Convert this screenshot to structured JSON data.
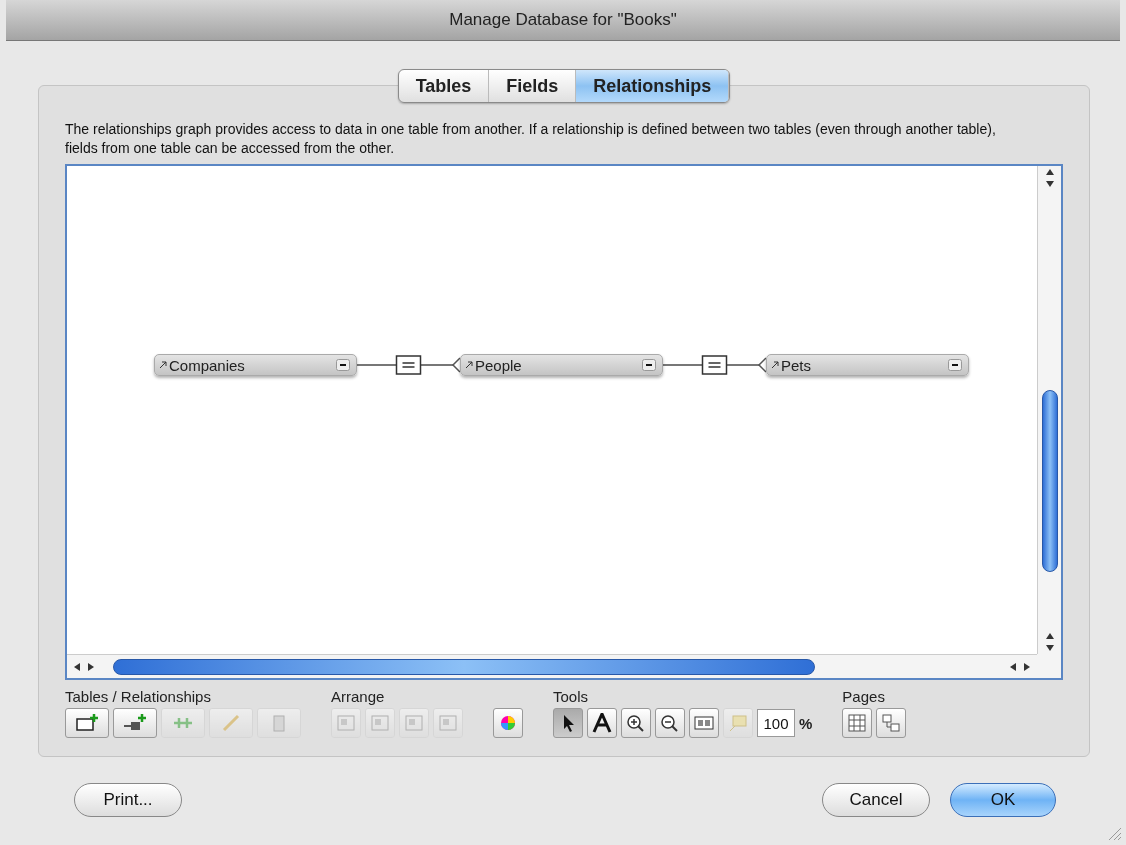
{
  "window": {
    "title": "Manage Database for \"Books\""
  },
  "tabs": [
    {
      "label": "Tables",
      "selected": false
    },
    {
      "label": "Fields",
      "selected": false
    },
    {
      "label": "Relationships",
      "selected": true
    }
  ],
  "description": "The relationships graph provides access to data in one table from another. If a relationship is defined between two tables (even through another table), fields from one table can be accessed from the other.",
  "graph": {
    "tables": [
      {
        "name": "Companies"
      },
      {
        "name": "People"
      },
      {
        "name": "Pets"
      }
    ],
    "relationships": [
      {
        "kind": "equal"
      },
      {
        "kind": "equal"
      }
    ]
  },
  "toolbar": [
    {
      "label": "Tables / Relationships",
      "buttons": [
        {
          "kind": "add-table",
          "disabled": false
        },
        {
          "kind": "add-relationship",
          "disabled": false
        },
        {
          "kind": "duplicate",
          "disabled": true
        },
        {
          "kind": "edit",
          "disabled": true
        },
        {
          "kind": "delete",
          "disabled": true
        }
      ]
    },
    {
      "label": "Arrange",
      "buttons": [
        {
          "kind": "align-left",
          "disabled": true
        },
        {
          "kind": "align-top",
          "disabled": true
        },
        {
          "kind": "distribute",
          "disabled": true
        },
        {
          "kind": "resize",
          "disabled": true
        }
      ]
    },
    {
      "buttons": [
        {
          "kind": "color",
          "disabled": false
        }
      ]
    },
    {
      "label": "Tools",
      "buttons": [
        {
          "kind": "pointer",
          "disabled": false,
          "selected": true
        },
        {
          "kind": "text",
          "disabled": false,
          "selected": false
        },
        {
          "kind": "zoom-in",
          "disabled": false,
          "selected": false
        },
        {
          "kind": "zoom-out",
          "disabled": false,
          "selected": false
        },
        {
          "kind": "fit",
          "disabled": false,
          "selected": false
        },
        {
          "kind": "note",
          "disabled": true,
          "selected": false
        }
      ],
      "zoom_value": "100",
      "zoom_unit": "%"
    },
    {
      "label": "Pages",
      "buttons": [
        {
          "kind": "grid",
          "disabled": false
        },
        {
          "kind": "page-breaks",
          "disabled": false
        }
      ]
    }
  ],
  "buttons": [
    {
      "label": "Print...",
      "default": false
    },
    {
      "label": "Cancel",
      "default": false
    },
    {
      "label": "OK",
      "default": true
    }
  ]
}
